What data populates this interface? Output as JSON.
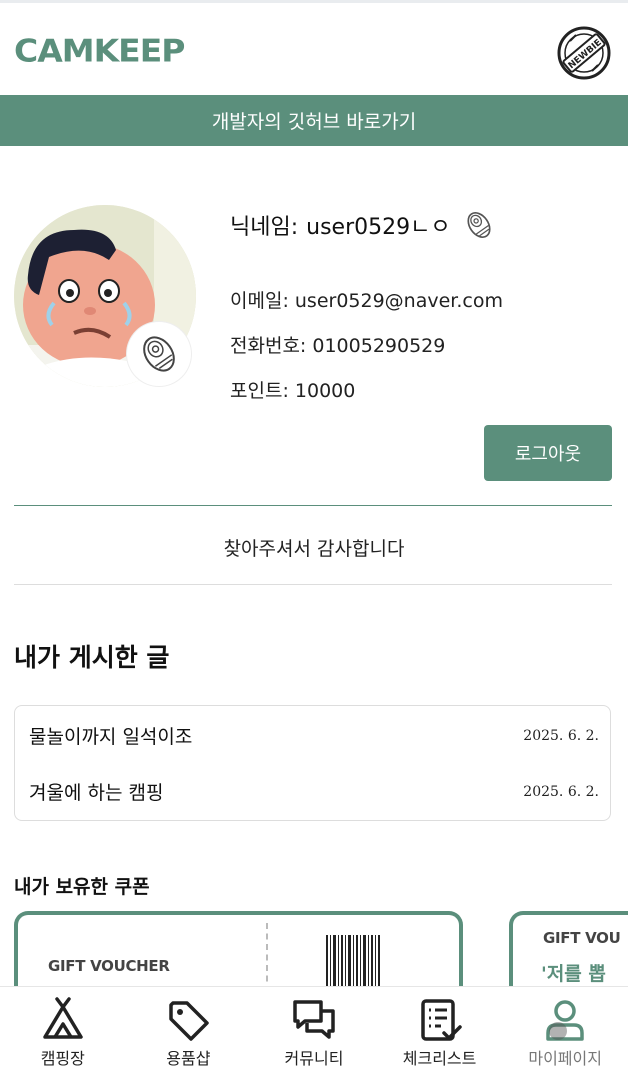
{
  "header": {
    "logo": "CAMKEEP",
    "badge_icon": "newbie-badge-icon",
    "badge_text": "NEWBIE"
  },
  "banner": {
    "label": "개발자의 깃허브 바로가기"
  },
  "profile": {
    "nickname_label": "닉네임:",
    "nickname": "user0529ㄴㅇ",
    "email_label": "이메일:",
    "email": "user0529@naver.com",
    "phone_label": "전화번호:",
    "phone": "01005290529",
    "points_label": "포인트:",
    "points": "10000",
    "logout_label": "로그아웃"
  },
  "thanks": "찾아주셔서 감사합니다",
  "posts": {
    "title": "내가 게시한 글",
    "items": [
      {
        "title": "물놀이까지 일석이조",
        "date": "2025. 6. 2."
      },
      {
        "title": "겨울에 하는 캠핑",
        "date": "2025. 6. 2."
      }
    ]
  },
  "coupons": {
    "title": "내가 보유한 쿠폰",
    "items": [
      {
        "label": "GIFT VOUCHER"
      },
      {
        "label": "GIFT VOU",
        "subtitle": "'저를 뽑"
      }
    ]
  },
  "tabbar": {
    "items": [
      {
        "label": "캠핑장",
        "icon": "tent-icon"
      },
      {
        "label": "용품샵",
        "icon": "tag-icon"
      },
      {
        "label": "커뮤니티",
        "icon": "chat-icon"
      },
      {
        "label": "체크리스트",
        "icon": "checklist-icon"
      },
      {
        "label": "마이페이지",
        "icon": "user-icon"
      }
    ],
    "active": "마이페이지"
  },
  "colors": {
    "brand": "#5b8f7c"
  }
}
